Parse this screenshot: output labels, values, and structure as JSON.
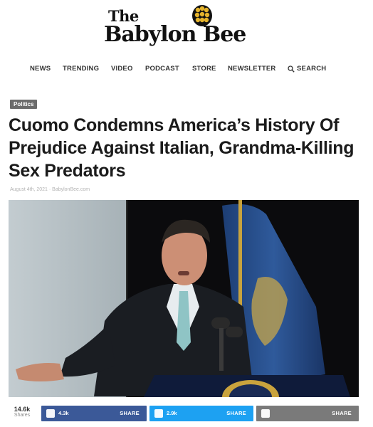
{
  "site": {
    "logo_line1": "The",
    "logo_line2": "Babylon Bee",
    "logo_icon": "bee-icon"
  },
  "nav": {
    "items": [
      "NEWS",
      "TRENDING",
      "VIDEO",
      "PODCAST",
      "STORE",
      "NEWSLETTER"
    ],
    "search_label": "SEARCH",
    "search_icon": "search-icon"
  },
  "article": {
    "category": "Politics",
    "headline": "Cuomo Condemns America’s History Of Prejudice Against Italian, Grandma-Killing Sex Predators",
    "byline": "August 4th, 2021 · BabylonBee.com"
  },
  "share": {
    "total": "14.6k",
    "total_label": "Shares",
    "buttons": [
      {
        "network": "facebook",
        "icon": "facebook-icon",
        "count": "4.3k",
        "label": "SHARE",
        "color": "#3b5998"
      },
      {
        "network": "twitter",
        "icon": "twitter-icon",
        "count": "2.9k",
        "label": "SHARE",
        "color": "#1da1f2"
      },
      {
        "network": "email",
        "icon": "email-icon",
        "count": "",
        "label": "SHARE",
        "color": "#7a7a7a"
      }
    ]
  }
}
